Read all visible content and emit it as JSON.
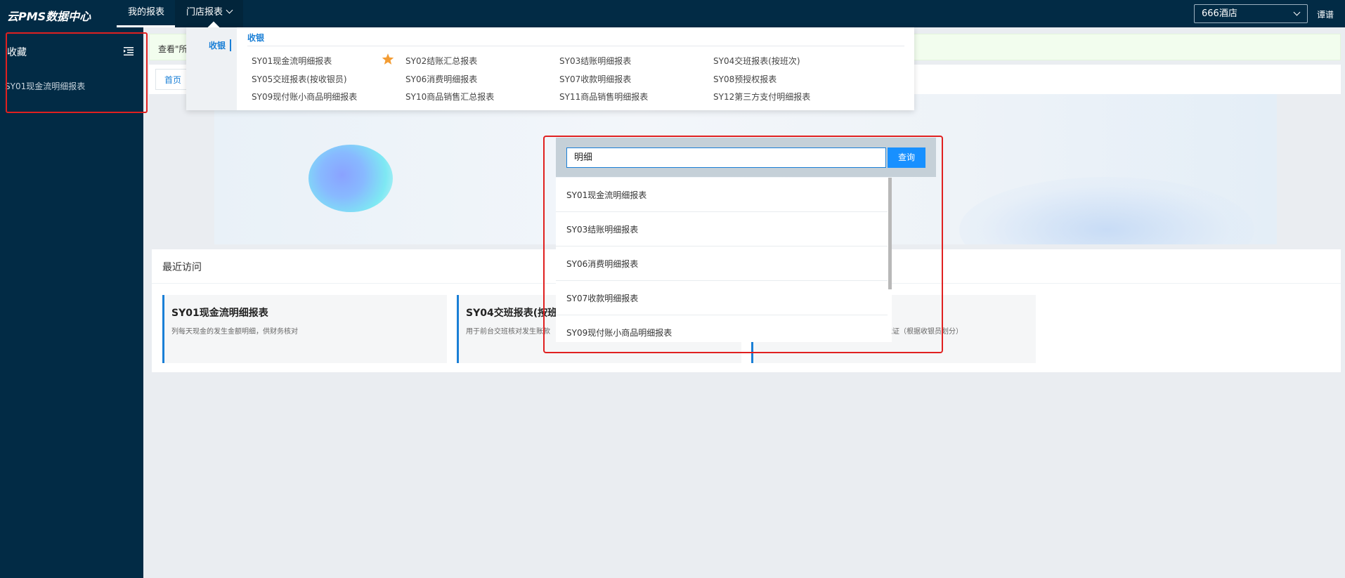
{
  "topbar": {
    "brand": "云PMS数据中心",
    "nav_my_reports": "我的报表",
    "nav_store_reports": "门店报表",
    "hotel_select": "666酒店",
    "user": "谭谱"
  },
  "sidebar": {
    "title": "收藏",
    "items": [
      "SY01现金流明细报表"
    ]
  },
  "main": {
    "notice": "查看\"所",
    "home_tab": "首页",
    "recent_title": "最近访问",
    "cards": [
      {
        "title": "SY01现金流明细报表",
        "desc": "列每天现金的发生金额明细，供财务核对"
      },
      {
        "title": "SY04交班报表(按班",
        "desc": "用于前台交班核对发生账款"
      },
      {
        "title": "",
        "desc": "款凭证（根据收银员划分）"
      }
    ]
  },
  "mega_menu": {
    "category": "收银",
    "heading": "收银",
    "items": [
      "SY01现金流明细报表",
      "SY02结账汇总报表",
      "SY03结账明细报表",
      "SY04交班报表(按班次)",
      "SY05交班报表(按收银员)",
      "SY06消费明细报表",
      "SY07收款明细报表",
      "SY08预授权报表",
      "SY09现付账小商品明细报表",
      "SY10商品销售汇总报表",
      "SY11商品销售明细报表",
      "SY12第三方支付明细报表"
    ],
    "favorite_icon_color": "#f39c33"
  },
  "search": {
    "query": "明细",
    "button": "查询",
    "results": [
      "SY01现金流明细报表",
      "SY03结账明细报表",
      "SY06消费明细报表",
      "SY07收款明细报表",
      "SY09现付账小商品明细报表"
    ]
  },
  "colors": {
    "topbar_bg": "#022b45",
    "accent": "#1a7fd6",
    "highlight_box": "#e02020"
  }
}
